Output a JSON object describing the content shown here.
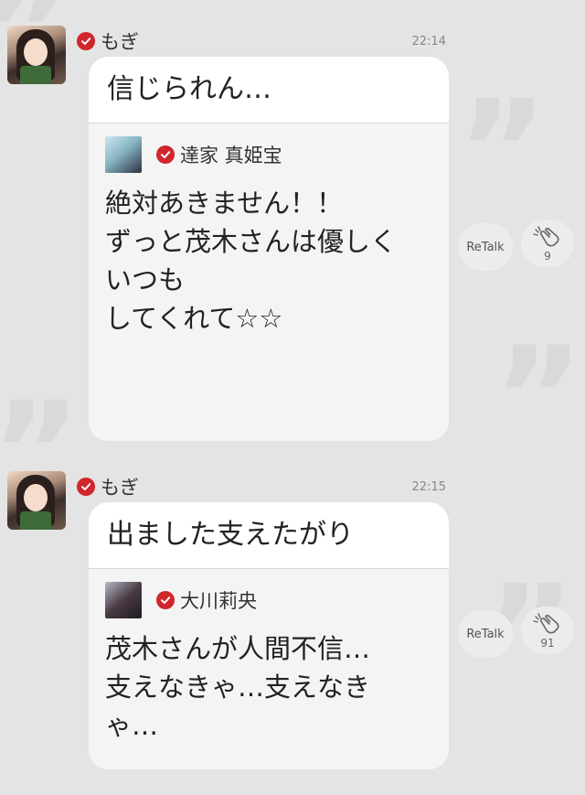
{
  "posts": [
    {
      "author": "もぎ",
      "time": "22:14",
      "message": "信じられん…",
      "quote": {
        "author": "達家 真姫宝",
        "body": "絶対あきません！！\nずっと茂木さんは優しく\nいつも\nしてくれて☆☆"
      },
      "retalk_label": "ReTalk",
      "clap_count": "9"
    },
    {
      "author": "もぎ",
      "time": "22:15",
      "message": "出ました支えたがり",
      "quote": {
        "author": "大川莉央",
        "body": "茂木さんが人間不信…\n支えなきゃ…支えなき\nゃ…"
      },
      "retalk_label": "ReTalk",
      "clap_count": "91"
    }
  ],
  "icons": {
    "verified": "verified-check-icon",
    "clap": "clap-icon"
  },
  "colors": {
    "verified": "#d0262c",
    "background": "#e4e4e4"
  }
}
